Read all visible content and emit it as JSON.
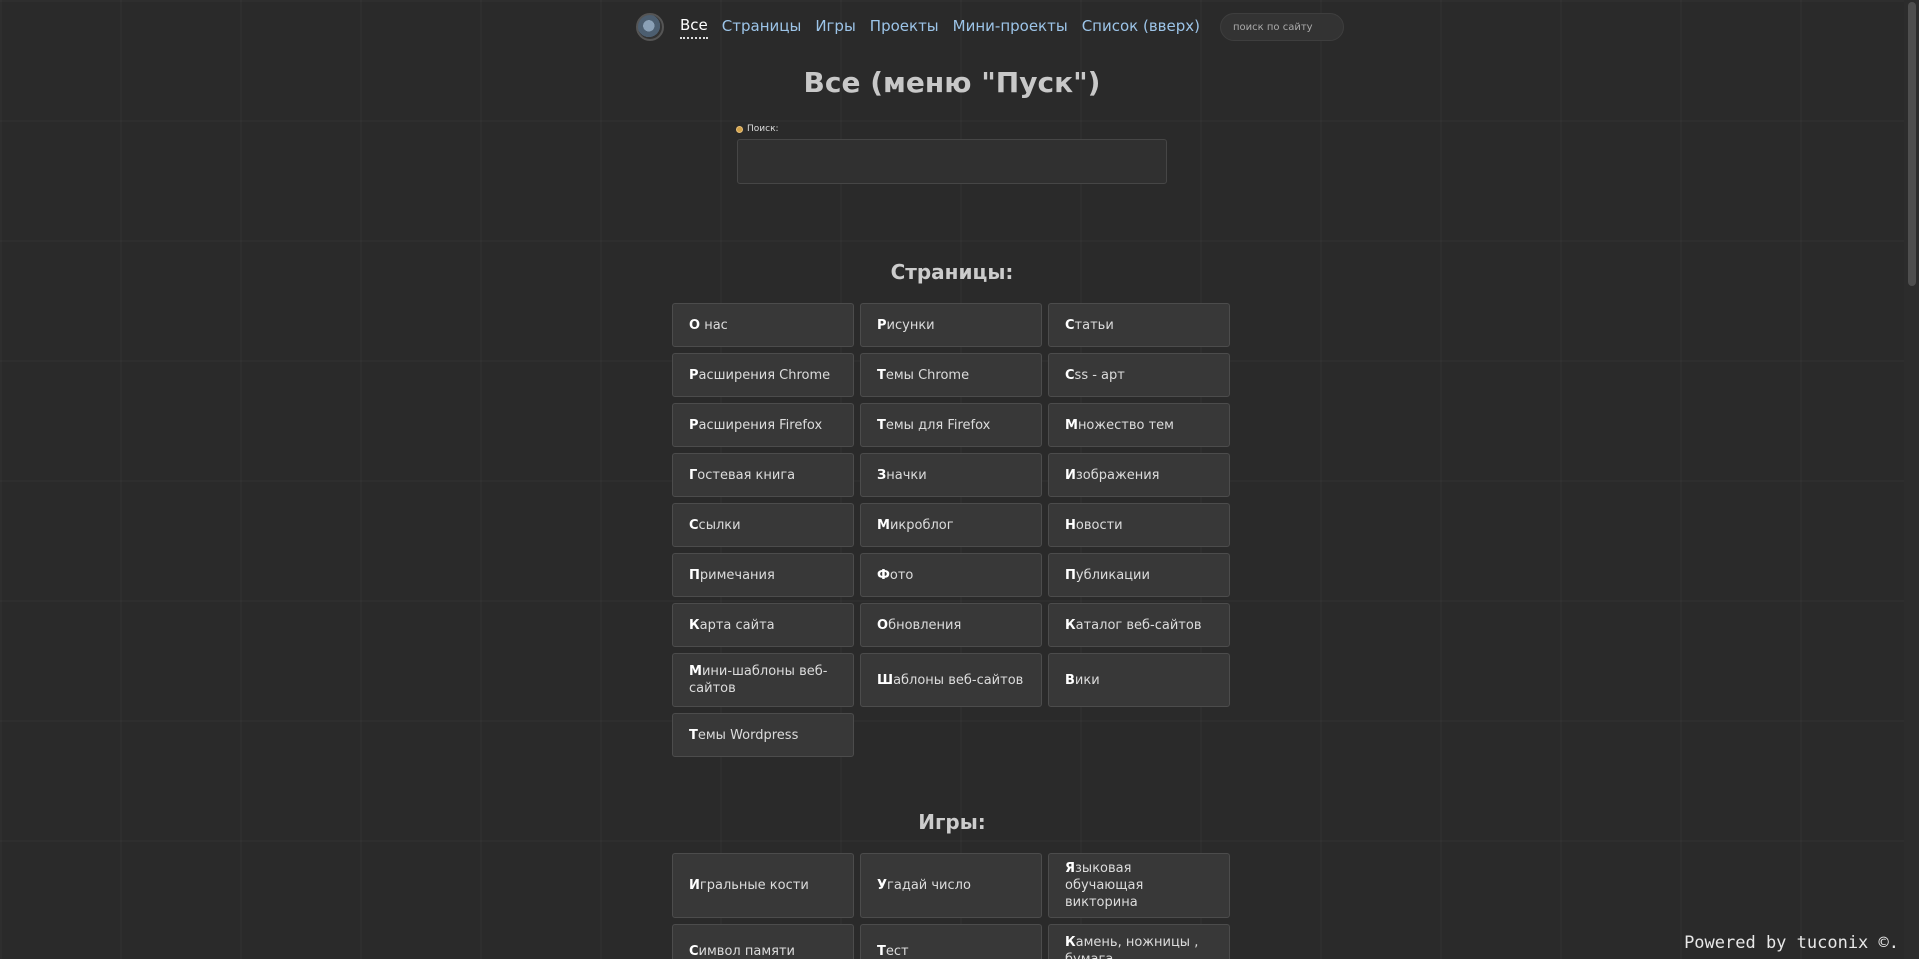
{
  "nav": {
    "logo": "site-logo",
    "items": [
      {
        "label": "Все",
        "active": true
      },
      {
        "label": "Страницы",
        "active": false
      },
      {
        "label": "Игры",
        "active": false
      },
      {
        "label": "Проекты",
        "active": false
      },
      {
        "label": "Мини-проекты",
        "active": false
      },
      {
        "label": "Список (вверх)",
        "active": false
      }
    ],
    "search_placeholder": "поиск по сайту"
  },
  "page_title": "Все (меню \"Пуск\")",
  "search": {
    "label": "Поиск:",
    "value": ""
  },
  "sections": [
    {
      "title": "Страницы:",
      "items": [
        {
          "first": "О",
          "rest": " нас"
        },
        {
          "first": "Р",
          "rest": "исунки"
        },
        {
          "first": "С",
          "rest": "татьи"
        },
        {
          "first": "Р",
          "rest": "асширения Chrome"
        },
        {
          "first": "Т",
          "rest": "емы Chrome"
        },
        {
          "first": "C",
          "rest": "ss - арт"
        },
        {
          "first": "Р",
          "rest": "асширения Firefox"
        },
        {
          "first": "Т",
          "rest": "емы для Firefox"
        },
        {
          "first": "М",
          "rest": "ножество тем"
        },
        {
          "first": "Г",
          "rest": "остевая книга"
        },
        {
          "first": "З",
          "rest": "начки"
        },
        {
          "first": "И",
          "rest": "зображения"
        },
        {
          "first": "С",
          "rest": "сылки"
        },
        {
          "first": "М",
          "rest": "икроблог"
        },
        {
          "first": "Н",
          "rest": "овости"
        },
        {
          "first": "П",
          "rest": "римечания"
        },
        {
          "first": "Ф",
          "rest": "ото"
        },
        {
          "first": "П",
          "rest": "убликации"
        },
        {
          "first": "К",
          "rest": "арта сайта"
        },
        {
          "first": "О",
          "rest": "бновления"
        },
        {
          "first": "К",
          "rest": "аталог веб-сайтов"
        },
        {
          "first": "М",
          "rest": "ини-шаблоны веб-сайтов"
        },
        {
          "first": "Ш",
          "rest": "аблоны веб-сайтов"
        },
        {
          "first": "В",
          "rest": "ики"
        },
        {
          "first": "Т",
          "rest": "емы Wordpress"
        }
      ]
    },
    {
      "title": "Игры:",
      "items": [
        {
          "first": "И",
          "rest": "гральные кости"
        },
        {
          "first": "У",
          "rest": "гадай число"
        },
        {
          "first": "Я",
          "rest": "зыковая обучающая викторина"
        },
        {
          "first": "С",
          "rest": "имвол памяти"
        },
        {
          "first": "Т",
          "rest": "ест"
        },
        {
          "first": "К",
          "rest": "амень, ножницы , бумага"
        }
      ]
    }
  ],
  "footer": "Powered by tuconix ©."
}
